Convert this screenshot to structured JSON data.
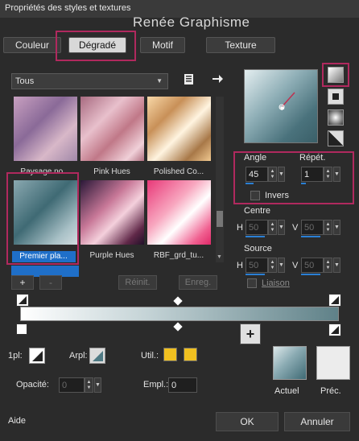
{
  "window": {
    "title": "Propriétés des styles et textures"
  },
  "watermark": "Renée Graphisme",
  "tabs": [
    {
      "label": "Couleur",
      "active": false
    },
    {
      "label": "Dégradé",
      "active": true
    },
    {
      "label": "Motif",
      "active": false
    },
    {
      "label": "Texture",
      "active": false
    }
  ],
  "category": {
    "selected": "Tous"
  },
  "gradients": [
    {
      "name": "Paysage no...",
      "selected": false
    },
    {
      "name": "Pink Hues",
      "selected": false
    },
    {
      "name": "Polished Co...",
      "selected": false
    },
    {
      "name": "Premier pla...",
      "selected": true
    },
    {
      "name": "Purple Hues",
      "selected": false
    },
    {
      "name": "RBF_grd_tu...",
      "selected": false
    }
  ],
  "buttons": {
    "add": "+",
    "remove": "-",
    "reset": "Réinit.",
    "save": "Enreg.",
    "ok": "OK",
    "cancel": "Annuler",
    "help": "Aide",
    "plus": "+"
  },
  "angle": {
    "label": "Angle",
    "value": "45"
  },
  "repeat": {
    "label": "Répét.",
    "value": "1"
  },
  "invert": {
    "label": "Invers",
    "checked": false
  },
  "center": {
    "label": "Centre",
    "h_label": "H",
    "h_value": "50",
    "v_label": "V",
    "v_value": "50"
  },
  "source": {
    "label": "Source",
    "h_label": "H",
    "h_value": "50",
    "v_label": "V",
    "v_value": "50"
  },
  "link": {
    "label": "Liaison",
    "checked": false
  },
  "bottom": {
    "ipl_label": "1pl:",
    "arpl_label": "Arpl:",
    "util_label": "Util.:",
    "opacity_label": "Opacité:",
    "opacity_value": "0",
    "empl_label": "Empl.:",
    "empl_value": "0",
    "current_label": "Actuel",
    "previous_label": "Préc."
  },
  "colors": {
    "accent_highlight": "#b0295e",
    "selection_blue": "#2a7fd4",
    "gradient_start": "#3f6a74",
    "gradient_end": "#c8d8dc",
    "swatch_yellow": "#f0c020"
  }
}
